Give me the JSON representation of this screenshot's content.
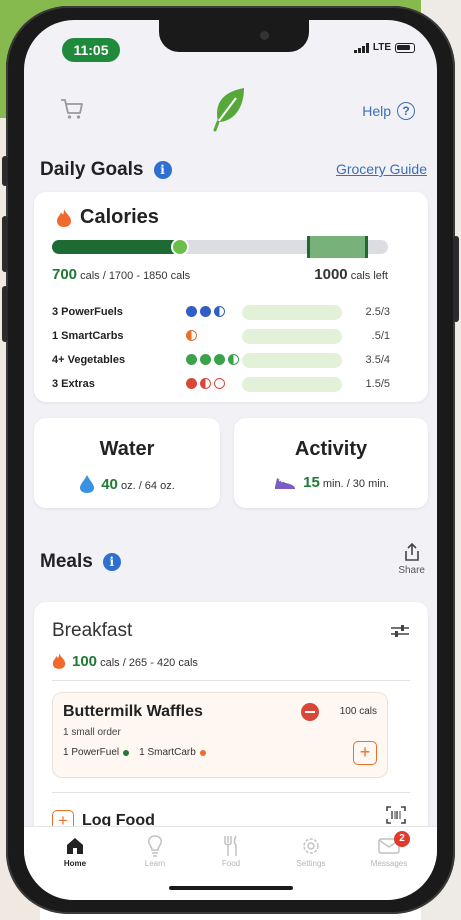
{
  "status_bar": {
    "time": "11:05",
    "network": "LTE"
  },
  "header": {
    "help_label": "Help",
    "help_glyph": "?"
  },
  "daily_goals": {
    "title": "Daily Goals",
    "info_glyph": "i",
    "grocery_link": "Grocery Guide"
  },
  "calories": {
    "title": "Calories",
    "consumed": "700",
    "consumed_suffix": " cals / 1700 - 1850 cals",
    "left_value": "1000",
    "left_suffix": " cals left",
    "progress_fraction": 0.38,
    "range_start_fraction": 0.76,
    "range_end_fraction": 0.94,
    "fuels": [
      {
        "label": "3  PowerFuels",
        "count": "2.5/3",
        "dots": [
          "full",
          "full",
          "half"
        ],
        "color": "#2f5fc4"
      },
      {
        "label": "1  SmartCarbs",
        "count": ".5/1",
        "dots": [
          "half"
        ],
        "color": "#e8702a"
      },
      {
        "label": "4+ Vegetables",
        "count": "3.5/4",
        "dots": [
          "full",
          "full",
          "full",
          "half"
        ],
        "color": "#3aa34a"
      },
      {
        "label": "3  Extras",
        "count": "1.5/5",
        "dots": [
          "full",
          "half",
          "empty"
        ],
        "color": "#d9473a"
      }
    ]
  },
  "water": {
    "title": "Water",
    "value": "40",
    "suffix": " oz. / 64 oz."
  },
  "activity": {
    "title": "Activity",
    "value": "15",
    "suffix": " min. / 30 min."
  },
  "meals": {
    "title": "Meals",
    "info_glyph": "i",
    "share_label": "Share",
    "breakfast": {
      "title": "Breakfast",
      "cals_value": "100",
      "cals_suffix": " cals / 265 - 420 cals",
      "food": {
        "name": "Buttermilk Waffles",
        "cals": "100 cals",
        "portion": "1 small order",
        "tag1": "1 PowerFuel",
        "tag2": "1 SmartCarb",
        "add_glyph": "+"
      },
      "log_food_label": "Log Food",
      "log_plus_glyph": "+"
    }
  },
  "tabbar": {
    "tabs": [
      {
        "label": "Home"
      },
      {
        "label": "Learn"
      },
      {
        "label": "Food"
      },
      {
        "label": "Settings"
      },
      {
        "label": "Messages"
      }
    ],
    "messages_badge": "2"
  },
  "colors": {
    "brand_green": "#1f7a35",
    "bar_dark_green": "#1d6b32",
    "accent_orange": "#e8702a",
    "link_blue": "#3d6fb6"
  }
}
